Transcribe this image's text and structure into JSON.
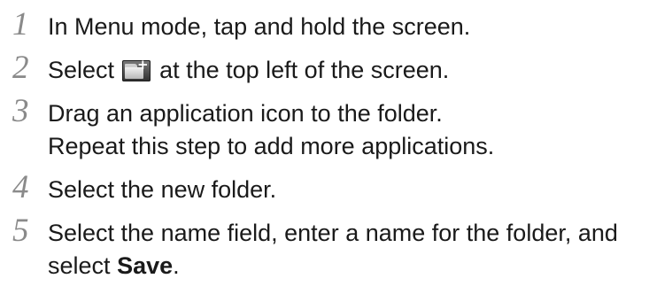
{
  "steps": [
    {
      "number": "1",
      "text": "In Menu mode, tap and hold the screen."
    },
    {
      "number": "2",
      "before_icon": "Select",
      "icon": "add-folder-icon",
      "after_icon": "at the top left of the screen."
    },
    {
      "number": "3",
      "line1": "Drag an application icon to the folder.",
      "line2": "Repeat this step to add more applications."
    },
    {
      "number": "4",
      "text": "Select the new folder."
    },
    {
      "number": "5",
      "line1": "Select the name field, enter a name for the folder, and",
      "line2_before": "select",
      "line2_bold": "Save",
      "line2_after": "."
    }
  ]
}
